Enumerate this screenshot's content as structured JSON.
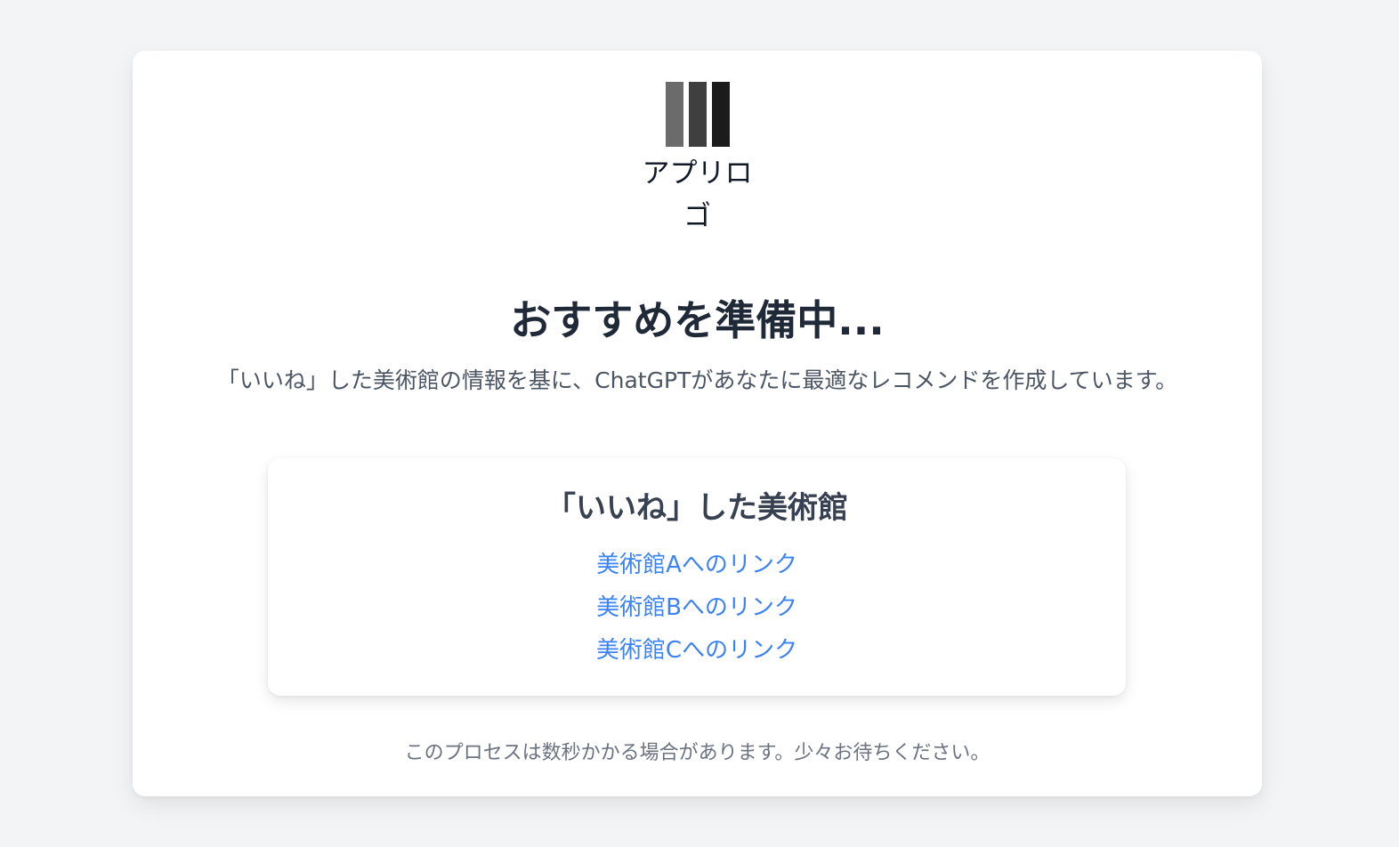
{
  "logo": {
    "label": "アプリロゴ",
    "colors": [
      "#6b6b6b",
      "#3f3f3f",
      "#1b1b1b"
    ]
  },
  "main": {
    "title": "おすすめを準備中...",
    "subtitle": "「いいね」した美術館の情報を基に、ChatGPTがあなたに最適なレコメンドを作成しています。"
  },
  "liked_museums": {
    "heading": "「いいね」した美術館",
    "links": [
      {
        "label": "美術館Aへのリンク"
      },
      {
        "label": "美術館Bへのリンク"
      },
      {
        "label": "美術館Cへのリンク"
      }
    ]
  },
  "footer_note": "このプロセスは数秒かかる場合があります。少々お待ちください。",
  "colors": {
    "background": "#f3f4f6",
    "card": "#ffffff",
    "link": "#3b82f6",
    "title": "#1f2937"
  }
}
